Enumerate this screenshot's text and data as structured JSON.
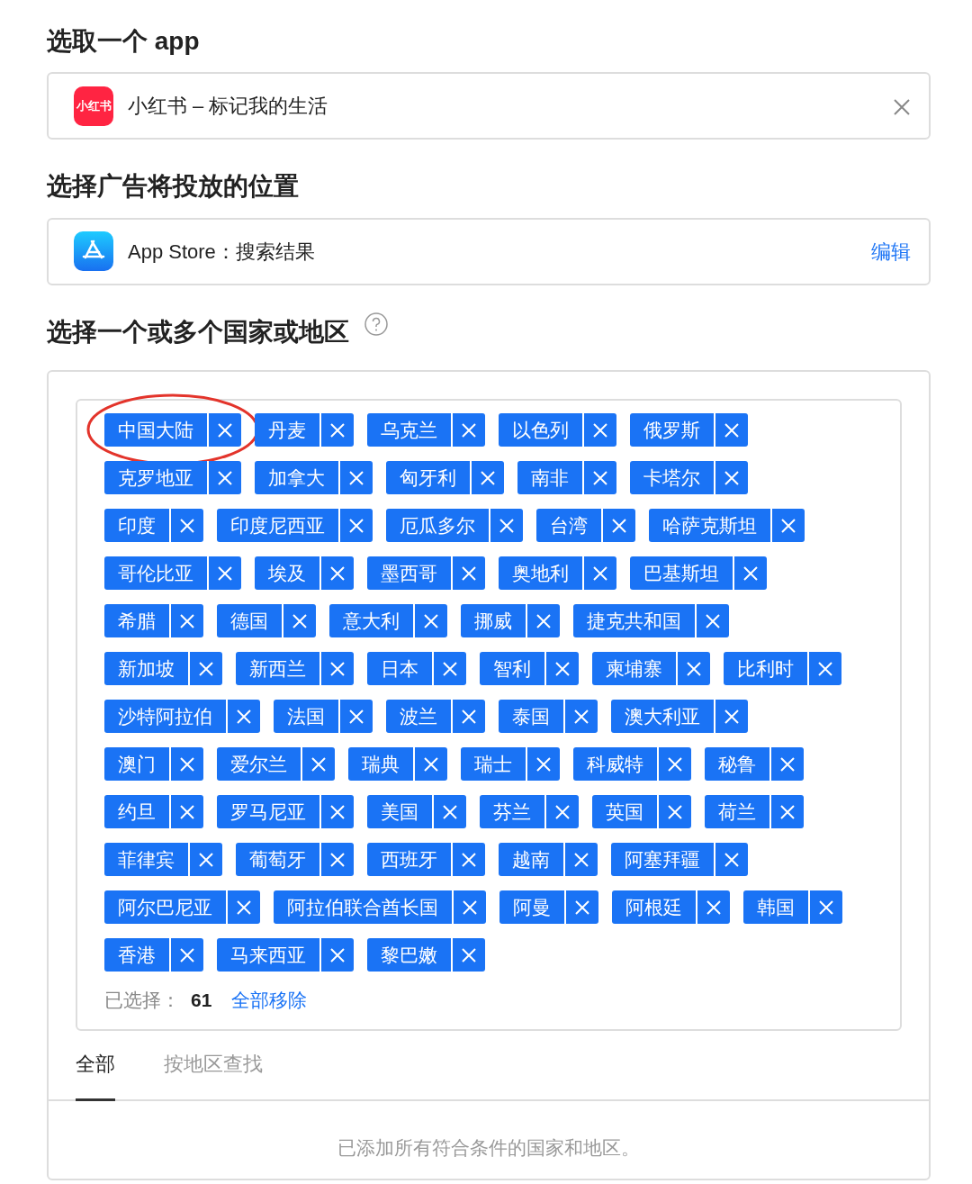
{
  "app_section": {
    "heading": "选取一个 app",
    "app_name": "小红书 – 标记我的生活",
    "app_icon_text": "小红书"
  },
  "placement_section": {
    "heading": "选择广告将投放的位置",
    "placement": "App Store：搜索结果",
    "edit_link": "编辑"
  },
  "country_section": {
    "heading": "选择一个或多个国家或地区",
    "tag_rows": [
      [
        {
          "label": "中国大陆",
          "circled": true
        },
        {
          "label": "丹麦",
          "circled": false
        },
        {
          "label": "乌克兰",
          "circled": false
        },
        {
          "label": "以色列",
          "circled": false
        },
        {
          "label": "俄罗斯",
          "circled": false
        }
      ],
      [
        {
          "label": "克罗地亚",
          "circled": false
        },
        {
          "label": "加拿大",
          "circled": false
        },
        {
          "label": "匈牙利",
          "circled": false
        },
        {
          "label": "南非",
          "circled": false
        },
        {
          "label": "卡塔尔",
          "circled": false
        }
      ],
      [
        {
          "label": "印度",
          "circled": false
        },
        {
          "label": "印度尼西亚",
          "circled": false
        },
        {
          "label": "厄瓜多尔",
          "circled": false
        },
        {
          "label": "台湾",
          "circled": false
        },
        {
          "label": "哈萨克斯坦",
          "circled": false
        }
      ],
      [
        {
          "label": "哥伦比亚",
          "circled": false
        },
        {
          "label": "埃及",
          "circled": false
        },
        {
          "label": "墨西哥",
          "circled": false
        },
        {
          "label": "奥地利",
          "circled": false
        },
        {
          "label": "巴基斯坦",
          "circled": false
        }
      ],
      [
        {
          "label": "希腊",
          "circled": false
        },
        {
          "label": "德国",
          "circled": false
        },
        {
          "label": "意大利",
          "circled": false
        },
        {
          "label": "挪威",
          "circled": false
        },
        {
          "label": "捷克共和国",
          "circled": false
        }
      ],
      [
        {
          "label": "新加坡",
          "circled": false
        },
        {
          "label": "新西兰",
          "circled": false
        },
        {
          "label": "日本",
          "circled": false
        },
        {
          "label": "智利",
          "circled": false
        },
        {
          "label": "柬埔寨",
          "circled": false
        },
        {
          "label": "比利时",
          "circled": false
        }
      ],
      [
        {
          "label": "沙特阿拉伯",
          "circled": false
        },
        {
          "label": "法国",
          "circled": false
        },
        {
          "label": "波兰",
          "circled": false
        },
        {
          "label": "泰国",
          "circled": false
        },
        {
          "label": "澳大利亚",
          "circled": false
        }
      ],
      [
        {
          "label": "澳门",
          "circled": false
        },
        {
          "label": "爱尔兰",
          "circled": false
        },
        {
          "label": "瑞典",
          "circled": false
        },
        {
          "label": "瑞士",
          "circled": false
        },
        {
          "label": "科威特",
          "circled": false
        },
        {
          "label": "秘鲁",
          "circled": false
        }
      ],
      [
        {
          "label": "约旦",
          "circled": false
        },
        {
          "label": "罗马尼亚",
          "circled": false
        },
        {
          "label": "美国",
          "circled": false
        },
        {
          "label": "芬兰",
          "circled": false
        },
        {
          "label": "英国",
          "circled": false
        },
        {
          "label": "荷兰",
          "circled": false
        }
      ],
      [
        {
          "label": "菲律宾",
          "circled": false
        },
        {
          "label": "葡萄牙",
          "circled": false
        },
        {
          "label": "西班牙",
          "circled": false
        },
        {
          "label": "越南",
          "circled": false
        },
        {
          "label": "阿塞拜疆",
          "circled": false
        }
      ],
      [
        {
          "label": "阿尔巴尼亚",
          "circled": false
        },
        {
          "label": "阿拉伯联合酋长国",
          "circled": false
        },
        {
          "label": "阿曼",
          "circled": false
        },
        {
          "label": "阿根廷",
          "circled": false
        },
        {
          "label": "韩国",
          "circled": false
        }
      ],
      [
        {
          "label": "香港",
          "circled": false
        },
        {
          "label": "马来西亚",
          "circled": false
        },
        {
          "label": "黎巴嫩",
          "circled": false
        }
      ]
    ],
    "selected_label": "已选择：",
    "selected_count": "61",
    "remove_all": "全部移除",
    "tabs": [
      {
        "label": "全部",
        "selected": true
      },
      {
        "label": "按地区查找",
        "selected": false
      }
    ],
    "empty_message": "已添加所有符合条件的国家和地区。"
  }
}
